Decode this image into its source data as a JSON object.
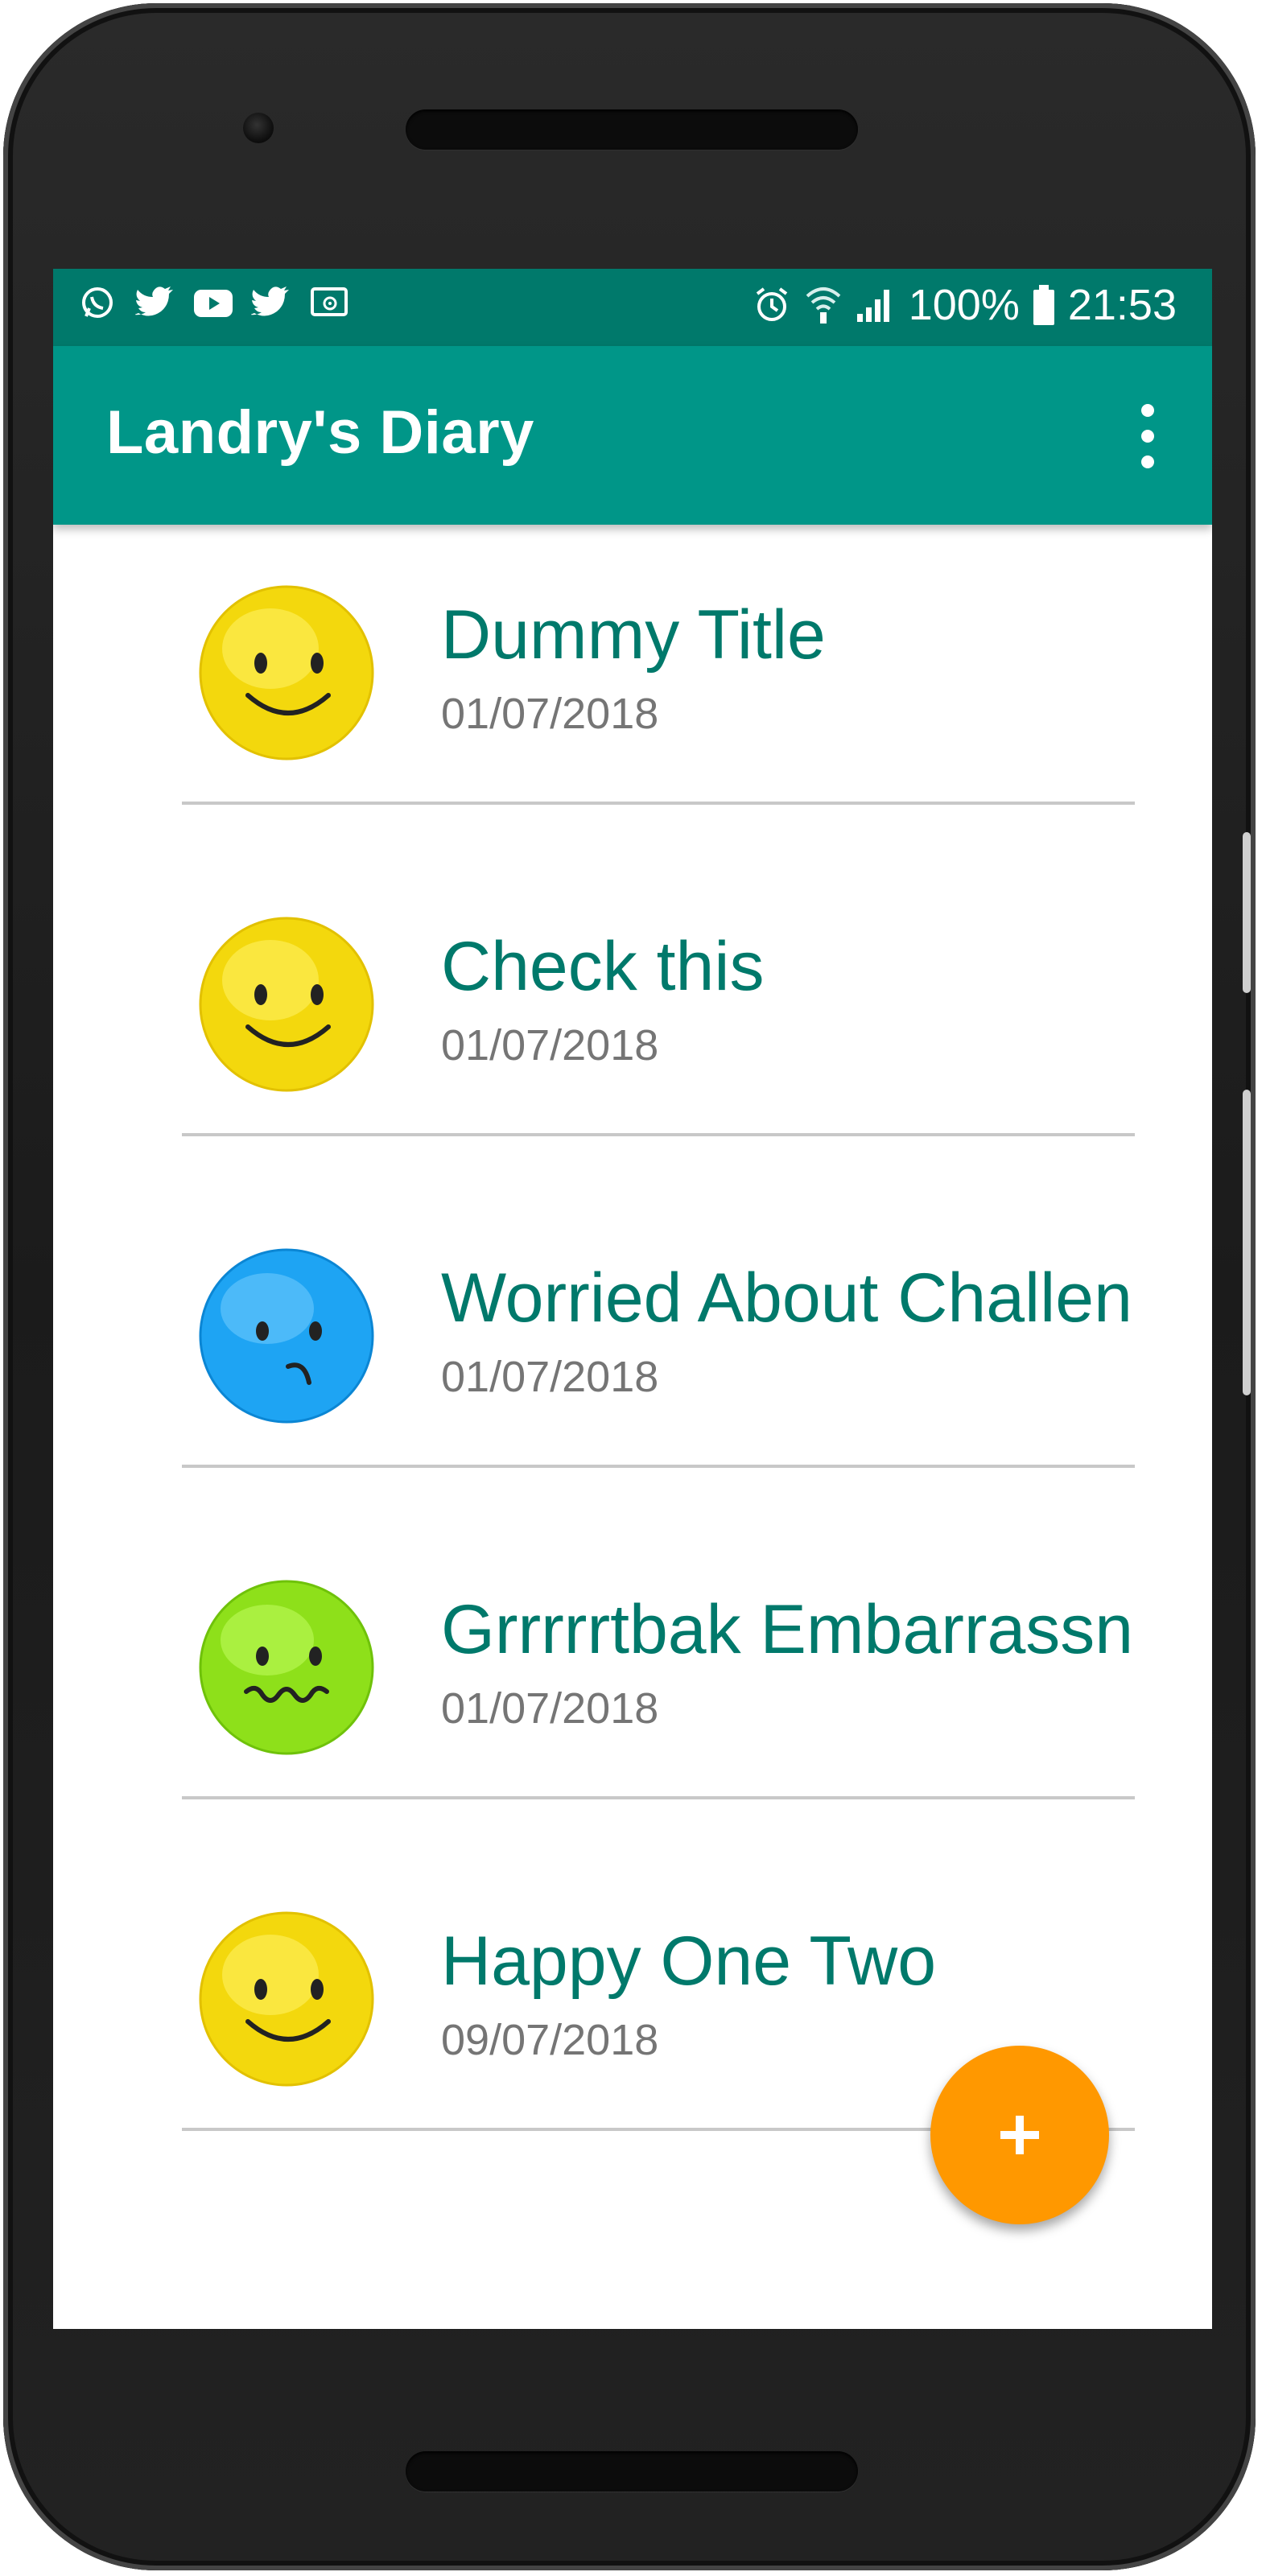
{
  "status_bar": {
    "notification_icons": [
      "whatsapp-icon",
      "twitter-icon",
      "youtube-icon",
      "twitter-icon",
      "cast-icon"
    ],
    "battery": "100%",
    "time": "21:53"
  },
  "app_bar": {
    "title": "Landry's Diary",
    "menu_icon": "overflow-menu-icon"
  },
  "entries": [
    {
      "title": "Dummy Title",
      "date": "01/07/2018",
      "mood": "happy",
      "color": "#f5d90f"
    },
    {
      "title": "Check this",
      "date": "01/07/2018",
      "mood": "happy",
      "color": "#f5d90f"
    },
    {
      "title": "Worried About Challen",
      "date": "01/07/2018",
      "mood": "worried",
      "color": "#29a9f5"
    },
    {
      "title": "Grrrrrtbak Embarrassn",
      "date": "01/07/2018",
      "mood": "embarrassed",
      "color": "#8ee11a"
    },
    {
      "title": "Happy One Two",
      "date": "09/07/2018",
      "mood": "happy",
      "color": "#f5d90f"
    }
  ],
  "fab": {
    "label": "+",
    "color": "#ff9800"
  },
  "colors": {
    "primary": "#009688",
    "primary_dark": "#00796b",
    "accent": "#ff9800"
  }
}
